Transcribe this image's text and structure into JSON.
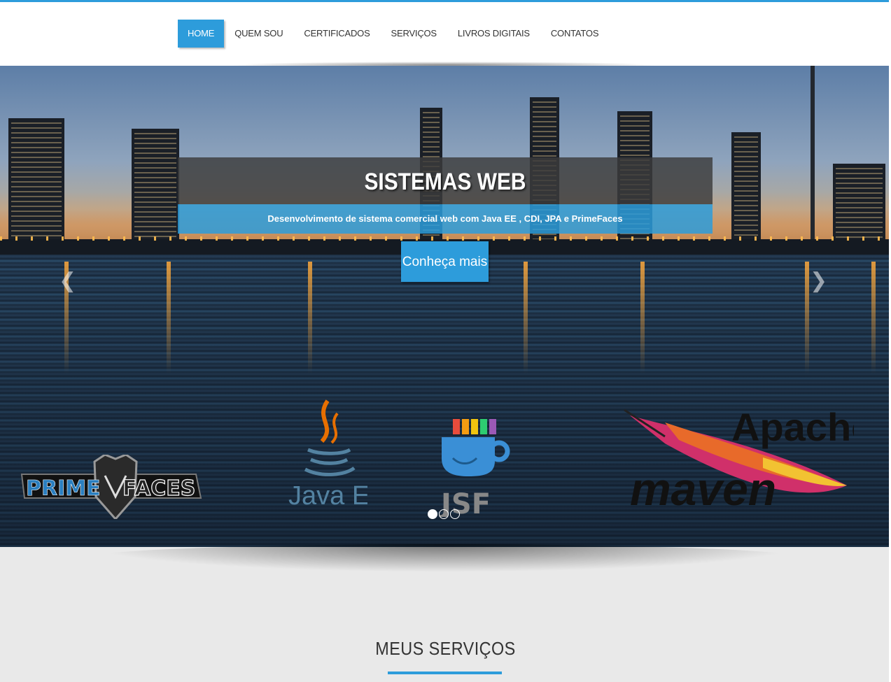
{
  "nav": {
    "items": [
      {
        "label": "HOME",
        "active": true
      },
      {
        "label": "QUEM SOU",
        "active": false
      },
      {
        "label": "CERTIFICADOS",
        "active": false
      },
      {
        "label": "SERVIÇOS",
        "active": false
      },
      {
        "label": "LIVROS DIGITAIS",
        "active": false
      },
      {
        "label": "CONTATOS",
        "active": false
      }
    ]
  },
  "hero": {
    "title": "SISTEMAS WEB",
    "subtitle": "Desenvolvimento de sistema comercial web com Java EE , CDI, JPA e PrimeFaces",
    "cta_label": "Conheça mais",
    "prev_icon": "chevron-left-icon",
    "next_icon": "chevron-right-icon",
    "logos": {
      "primefaces": {
        "left": "PRIME",
        "right": "FACES"
      },
      "javaee": {
        "text": "Java EE"
      },
      "jsf": {
        "text": "JSF"
      },
      "maven": {
        "top": "Apache",
        "bottom": "maven"
      }
    },
    "indicators": {
      "count": 3,
      "active_index": 0
    }
  },
  "services": {
    "title": "MEUS SERVIÇOS"
  },
  "colors": {
    "accent": "#2d9cdb",
    "caption_dark": "#3c3c3c"
  }
}
